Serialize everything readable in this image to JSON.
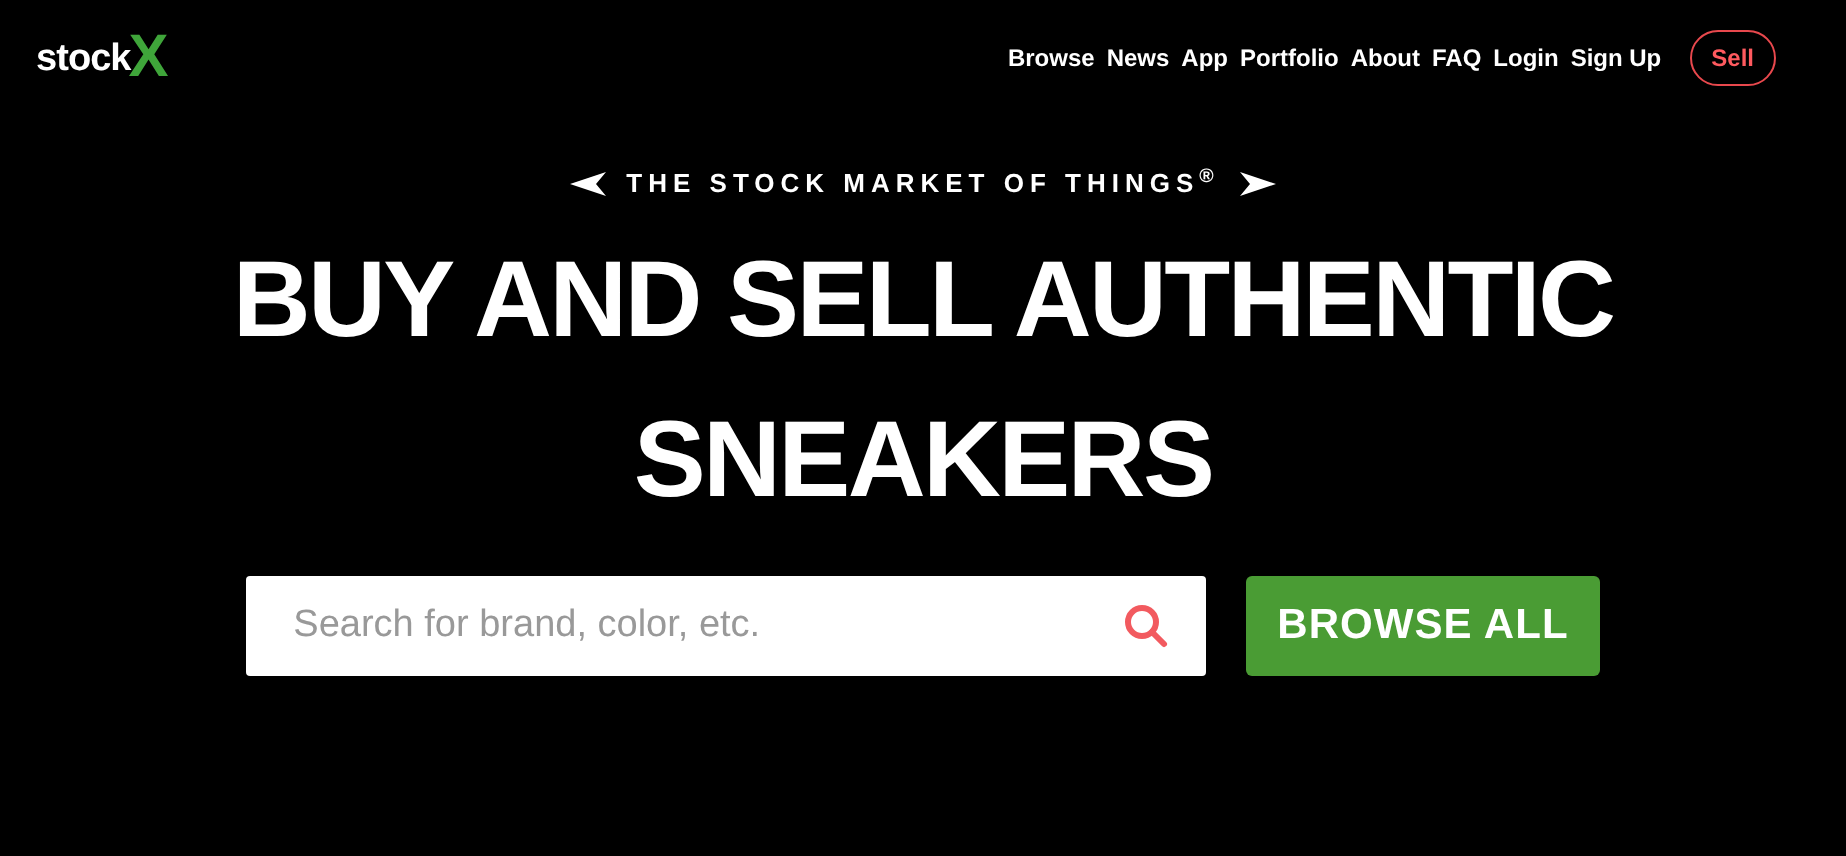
{
  "logo": {
    "text": "stock",
    "mark": "X"
  },
  "nav": {
    "links": [
      "Browse",
      "News",
      "App",
      "Portfolio",
      "About",
      "FAQ",
      "Login",
      "Sign Up"
    ],
    "sell_button": "Sell"
  },
  "hero": {
    "tagline": "THE STOCK MARKET OF THINGS$^{®}$",
    "headline_lines": [
      "BUY AND SELL AUTHENTIC",
      "SNEAKERS"
    ]
  },
  "search": {
    "placeholder": "Search for brand, color, etc."
  },
  "browse_button": "BROWSE ALL"
}
